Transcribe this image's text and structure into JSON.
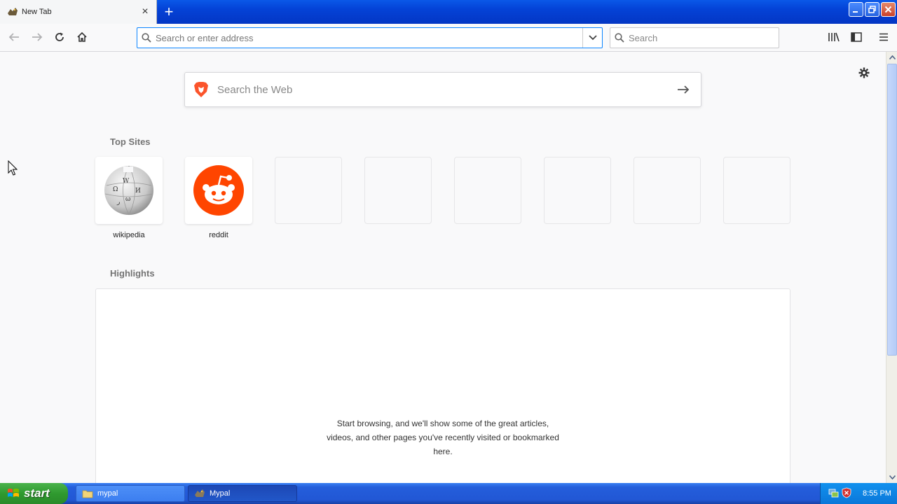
{
  "tab": {
    "title": "New Tab",
    "close": "×"
  },
  "new_tab": "+",
  "url_bar": {
    "placeholder": "Search or enter address"
  },
  "search_bar": {
    "placeholder": "Search"
  },
  "web_search": {
    "placeholder": "Search the Web"
  },
  "top_sites": {
    "title": "Top Sites",
    "sites": [
      {
        "label": "wikipedia",
        "icon": "wikipedia-globe-icon"
      },
      {
        "label": "reddit",
        "icon": "reddit-alien-icon"
      },
      {
        "label": "",
        "icon": ""
      },
      {
        "label": "",
        "icon": ""
      },
      {
        "label": "",
        "icon": ""
      },
      {
        "label": "",
        "icon": ""
      },
      {
        "label": "",
        "icon": ""
      },
      {
        "label": "",
        "icon": ""
      }
    ]
  },
  "highlights": {
    "title": "Highlights",
    "empty_message": "Start browsing, and we'll show some of the great articles, videos, and other pages you've recently visited or bookmarked here."
  },
  "taskbar": {
    "start_label": "start",
    "tasks": [
      {
        "label": "mypal",
        "icon": "folder-icon"
      },
      {
        "label": "Mypal",
        "icon": "mypal-icon"
      }
    ],
    "clock": "8:55 PM"
  },
  "colors": {
    "accent": "#0a84ff",
    "reddit": "#ff4500",
    "xp_blue": "#245edb",
    "xp_green": "#2f9a2f"
  }
}
